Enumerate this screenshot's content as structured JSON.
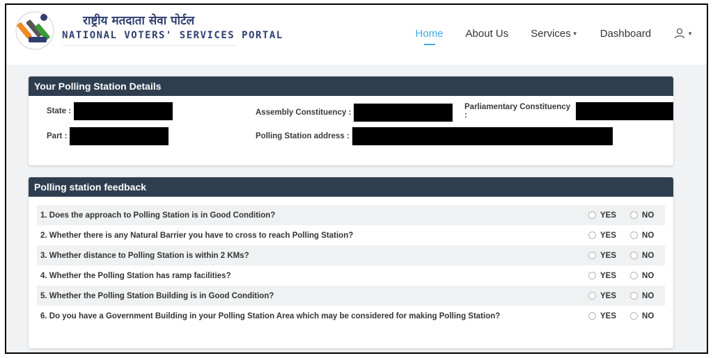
{
  "brand": {
    "hindi": "राष्ट्रीय मतदाता सेवा पोर्टल",
    "english": "NATIONAL VOTERS' SERVICES PORTAL"
  },
  "nav": {
    "home": "Home",
    "about": "About Us",
    "services": "Services",
    "dashboard": "Dashboard"
  },
  "details": {
    "title": "Your Polling Station Details",
    "state_label": "State :",
    "part_label": "Part :",
    "assembly_label": "Assembly Constituency :",
    "address_label": "Polling Station address :",
    "parliamentary_label": "Parliamentary Constituency :"
  },
  "feedback": {
    "title": "Polling station feedback",
    "yes_label": "YES",
    "no_label": "NO",
    "questions": [
      "1. Does the approach to Polling Station is in Good Condition?",
      "2. Whether there is any Natural Barrier you have to cross to reach Polling Station?",
      "3. Whether distance to Polling Station is within 2 KMs?",
      "4. Whether the Polling Station has ramp facilities?",
      "5. Whether the Polling Station Building is in Good Condition?",
      "6. Do you have a Government Building in your Polling Station Area which may be considered for making Polling Station?"
    ]
  },
  "colors": {
    "panel_header": "#2e3e4f",
    "active_nav": "#3fa9e6",
    "brand_text": "#2f3e6f"
  }
}
